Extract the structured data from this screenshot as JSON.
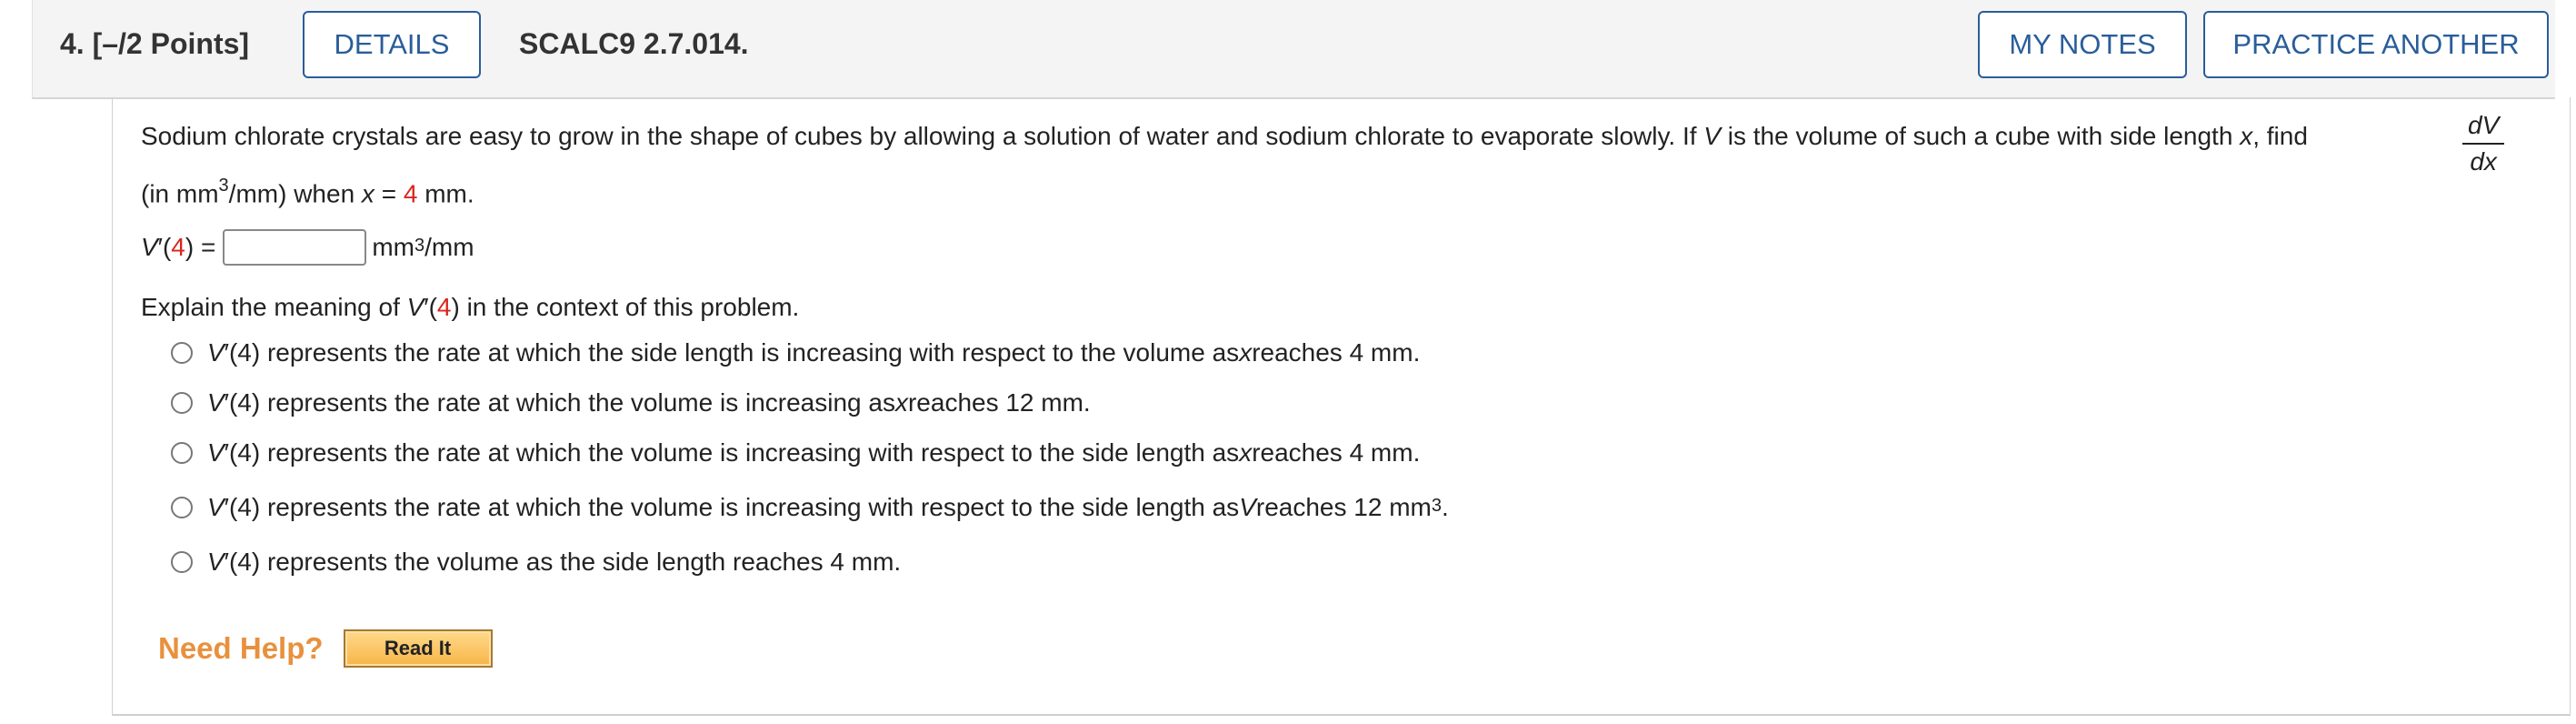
{
  "header": {
    "question_number": "4.  [–/2 Points]",
    "details_label": "DETAILS",
    "question_code": "SCALC9 2.7.014.",
    "my_notes_label": "MY NOTES",
    "practice_label": "PRACTICE ANOTHER"
  },
  "problem": {
    "sentence_a": "Sodium chlorate crystals are easy to grow in the shape of cubes by allowing a solution of water and sodium chlorate to evaporate slowly. If ",
    "var_V": "V",
    "sentence_b": " is the volume of such a cube with side length ",
    "var_x": "x",
    "sentence_c": ", find",
    "frac_num": "dV",
    "frac_den": "dx",
    "line2_a": "(in mm",
    "line2_sup": "3",
    "line2_b": "/mm) when ",
    "line2_x": "x",
    "line2_eq": " = ",
    "line2_val": "4",
    "line2_unit": " mm."
  },
  "answer": {
    "lhs_V": "V",
    "lhs_prime": "′(",
    "lhs_val": "4",
    "lhs_close": ") =",
    "input_value": "",
    "unit_a": "mm",
    "unit_sup": "3",
    "unit_b": "/mm"
  },
  "explain": {
    "a": "Explain the meaning of ",
    "V": "V",
    "prime": "′(",
    "val": "4",
    "b": ") in the context of this problem."
  },
  "options": [
    {
      "V": "V",
      "pre": "′(4) represents the rate at which the side length is increasing with respect to the volume as ",
      "var": "x",
      "post": " reaches 4 mm.",
      "sup": ""
    },
    {
      "V": "V",
      "pre": "′(4) represents the rate at which the volume is increasing as ",
      "var": "x",
      "post": " reaches 12 mm.",
      "sup": ""
    },
    {
      "V": "V",
      "pre": "′(4) represents the rate at which the volume is increasing with respect to the side length as ",
      "var": "x",
      "post": " reaches 4 mm.",
      "sup": ""
    },
    {
      "V": "V",
      "pre": "′(4) represents the rate at which the volume is increasing with respect to the side length as ",
      "var": "V",
      "post": " reaches 12 mm",
      "sup": "3",
      "tail": "."
    },
    {
      "V": "V",
      "pre": "′(4) represents the volume as the side length reaches 4 mm.",
      "var": "",
      "post": "",
      "sup": ""
    }
  ],
  "help": {
    "label": "Need Help?",
    "read_it_label": "Read It"
  },
  "colors": {
    "accent_blue": "#2a5d9a",
    "given_value_red": "#d9261c",
    "help_orange": "#e8913d"
  }
}
